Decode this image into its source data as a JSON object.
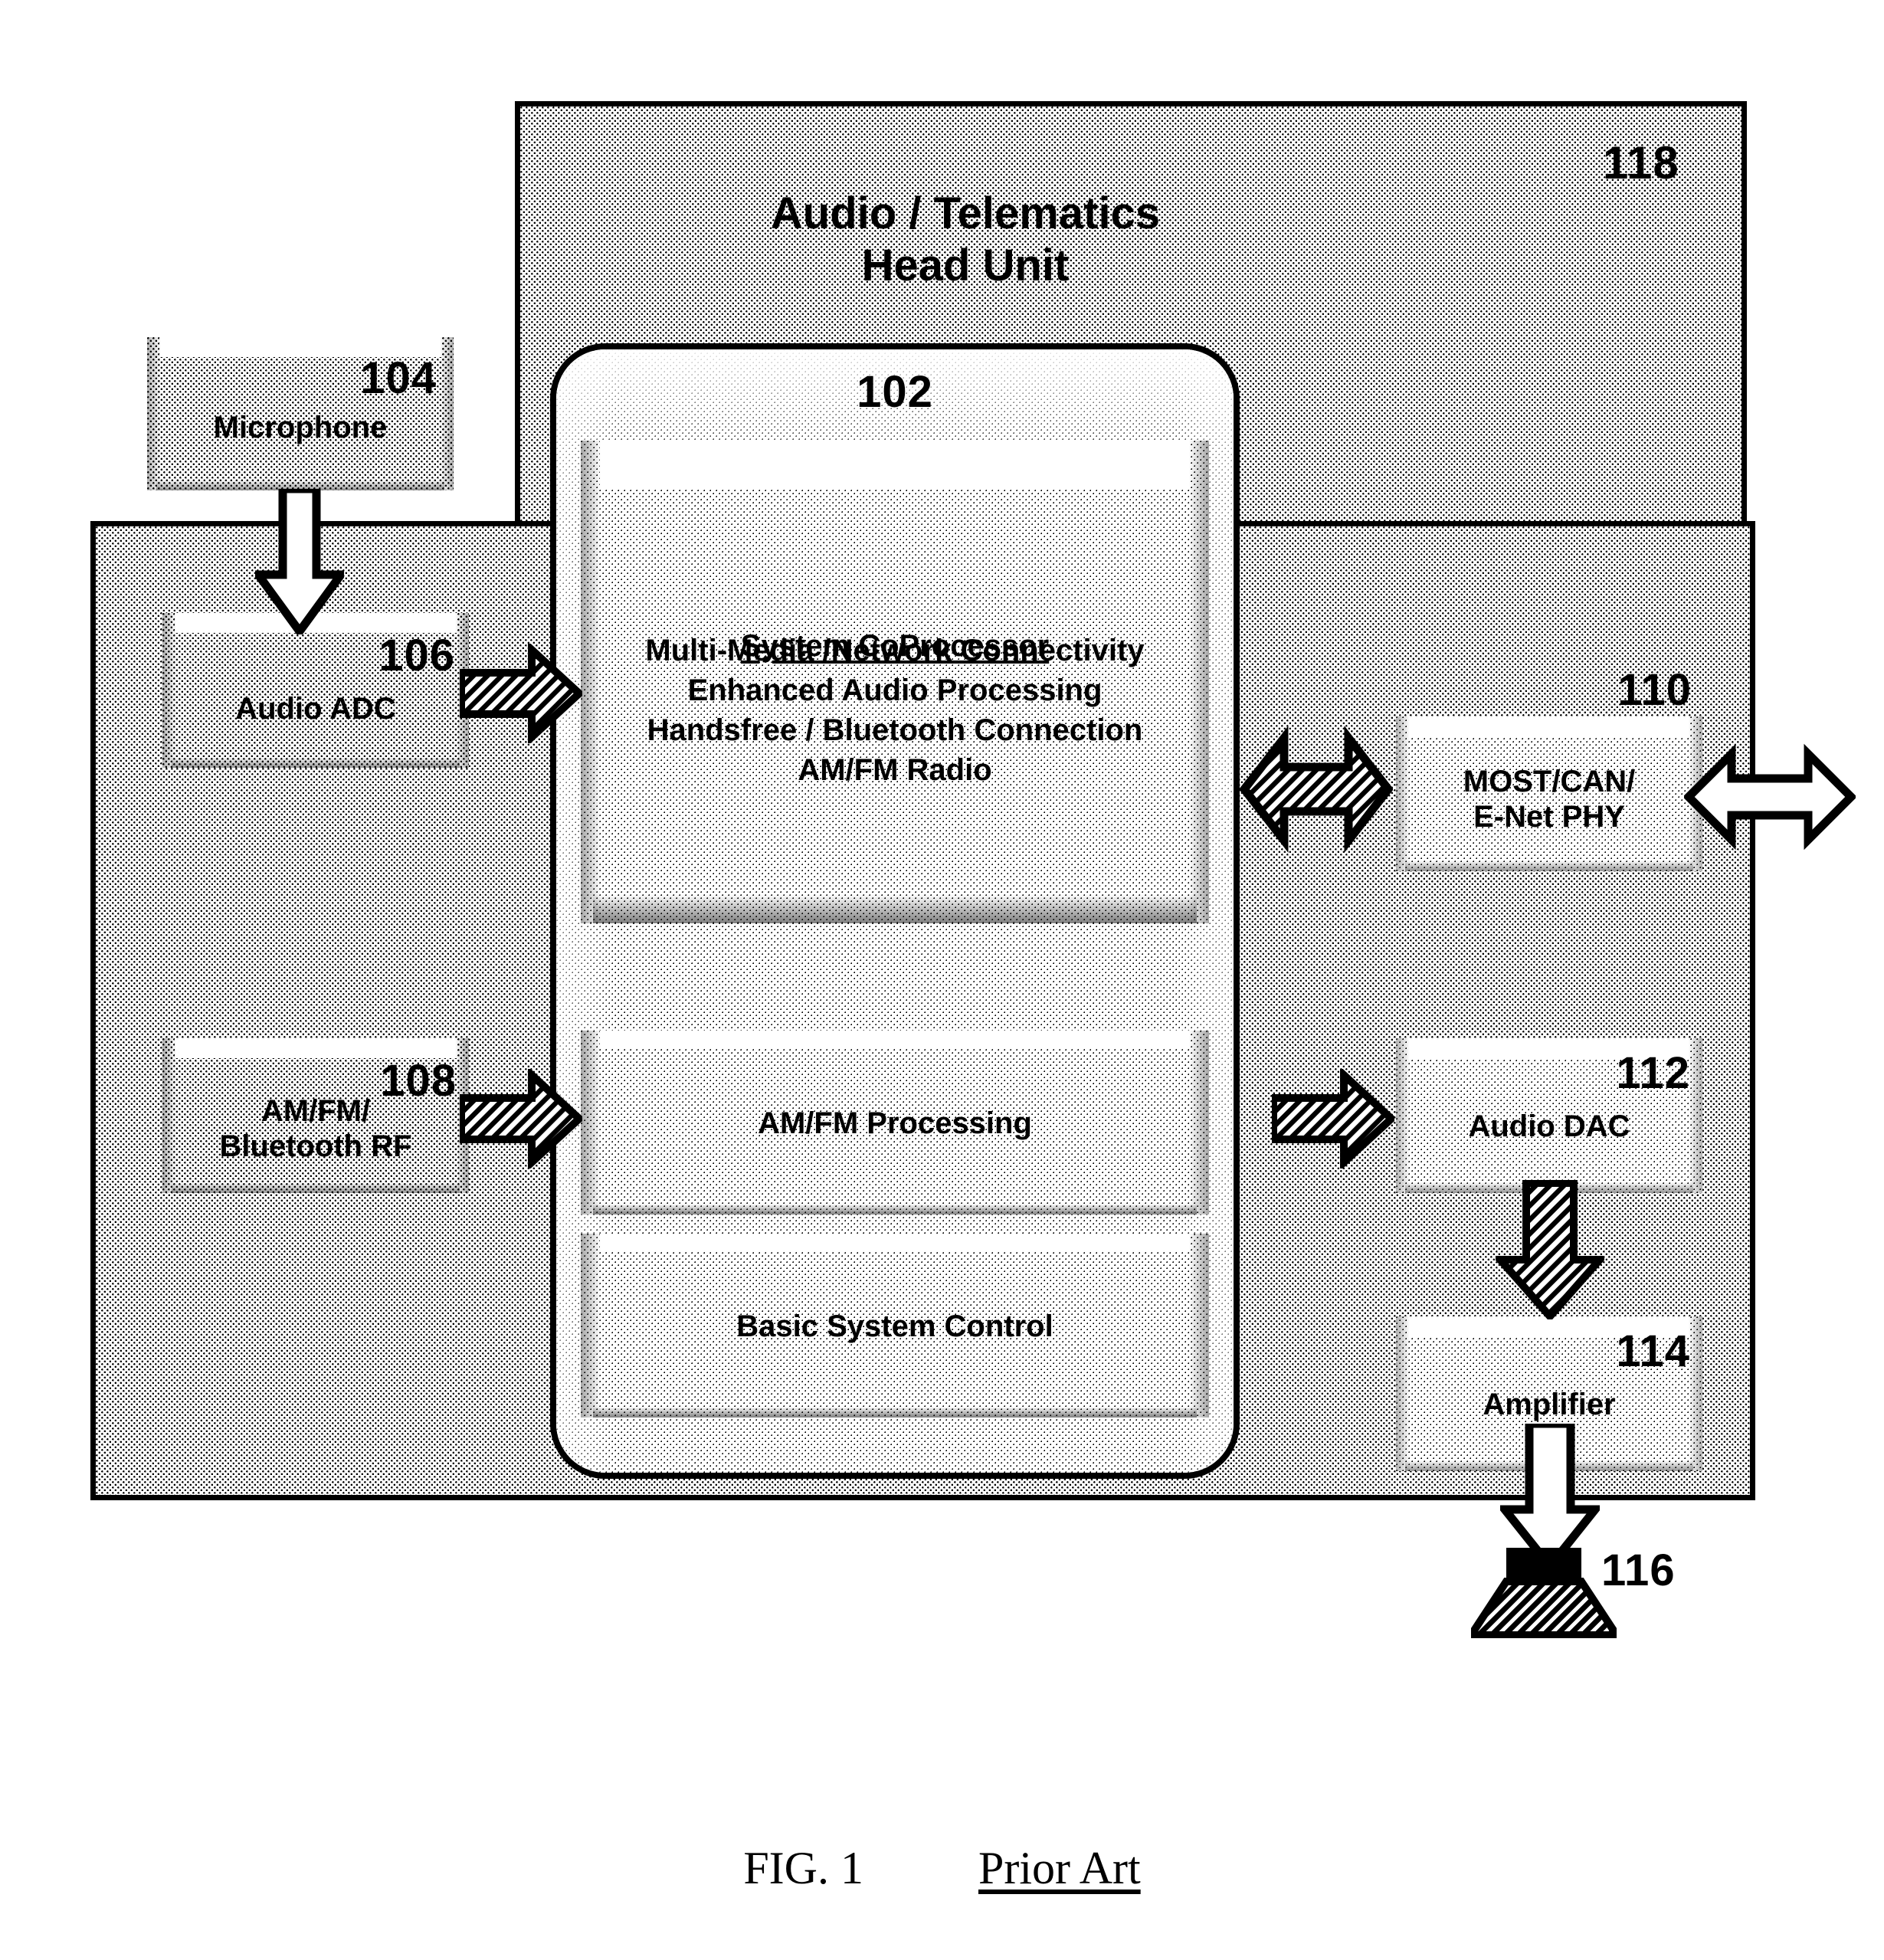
{
  "figure": {
    "caption_figure": "FIG. 1",
    "caption_note": "Prior Art"
  },
  "head_unit": {
    "ref": "118",
    "title": "Audio / Telematics\nHead Unit"
  },
  "processor": {
    "ref": "102",
    "panels": [
      {
        "name": "system-coprocessor",
        "heading": "System CoProcessor",
        "lines": "Multi-Media /Network Connectivity\nEnhanced Audio Processing\nHandsfree / Bluetooth Connection\nAM/FM Radio"
      },
      {
        "name": "amfm-processing",
        "heading": "AM/FM Processing",
        "lines": ""
      },
      {
        "name": "basic-system-control",
        "heading": "Basic System Control",
        "lines": ""
      }
    ]
  },
  "blocks": {
    "microphone": {
      "ref": "104",
      "label": "Microphone"
    },
    "audio_adc": {
      "ref": "106",
      "label": "Audio ADC"
    },
    "rf": {
      "ref": "108",
      "label": "AM/FM/\nBluetooth RF"
    },
    "most_can": {
      "ref": "110",
      "label": "MOST/CAN/\nE-Net PHY"
    },
    "audio_dac": {
      "ref": "112",
      "label": "Audio DAC"
    },
    "amplifier": {
      "ref": "114",
      "label": "Amplifier"
    },
    "speaker": {
      "ref": "116",
      "label": ""
    }
  },
  "arrows": [
    {
      "name": "mic-to-adc",
      "direction": "down",
      "style": "outline"
    },
    {
      "name": "adc-to-coprocessor",
      "direction": "right",
      "style": "hatched"
    },
    {
      "name": "rf-to-amfm",
      "direction": "right",
      "style": "hatched"
    },
    {
      "name": "coprocessor-to-most",
      "direction": "both",
      "style": "hatched"
    },
    {
      "name": "most-external",
      "direction": "both",
      "style": "outline"
    },
    {
      "name": "amfm-to-dac",
      "direction": "right",
      "style": "hatched"
    },
    {
      "name": "dac-to-amplifier",
      "direction": "down",
      "style": "hatched"
    },
    {
      "name": "amplifier-to-speaker",
      "direction": "down",
      "style": "outline"
    }
  ],
  "colors": {
    "ink": "#000000",
    "paper": "#ffffff"
  }
}
